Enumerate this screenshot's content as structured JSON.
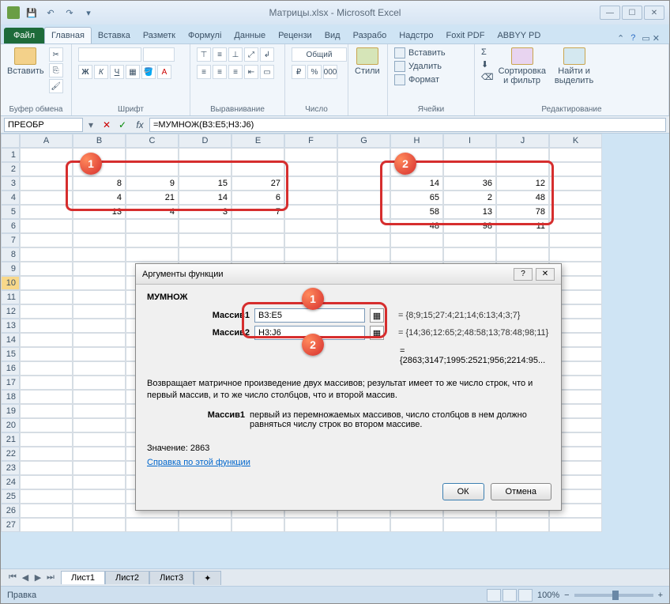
{
  "title": "Матрицы.xlsx - Microsoft Excel",
  "tabs": {
    "file": "Файл",
    "home": "Главная",
    "insert": "Вставка",
    "layout": "Разметк",
    "formulas": "Формулі",
    "data": "Данные",
    "review": "Рецензи",
    "view": "Вид",
    "dev": "Разрабо",
    "addins": "Надстро",
    "foxit": "Foxit PDF",
    "abbyy": "ABBYY PD"
  },
  "groups": {
    "clipboard": "Буфер обмена",
    "font": "Шрифт",
    "alignment": "Выравнивание",
    "number": "Число",
    "styles": "Стили",
    "cells": "Ячейки",
    "editing": "Редактирование"
  },
  "ribbon": {
    "paste": "Вставить",
    "general": "Общий",
    "styles": "Стили",
    "insert": "Вставить",
    "delete": "Удалить",
    "format": "Формат",
    "sort": "Сортировка и фильтр",
    "find": "Найти и выделить"
  },
  "name_box": "ПРЕОБР",
  "formula": "=МУМНОЖ(B3:E5;H3:J6)",
  "cols": [
    "A",
    "B",
    "C",
    "D",
    "E",
    "F",
    "G",
    "H",
    "I",
    "J",
    "K"
  ],
  "matrix1": [
    [
      8,
      9,
      15,
      27
    ],
    [
      4,
      21,
      14,
      6
    ],
    [
      13,
      4,
      3,
      7
    ]
  ],
  "matrix2": [
    [
      14,
      36,
      12
    ],
    [
      65,
      2,
      48
    ],
    [
      58,
      13,
      78
    ],
    [
      48,
      98,
      11
    ]
  ],
  "dialog": {
    "title": "Аргументы функции",
    "func": "МУМНОЖ",
    "arg1_label": "Массив1",
    "arg1_val": "B3:E5",
    "arg1_res": "= {8;9;15;27:4;21;14;6:13;4;3;7}",
    "arg2_label": "Массив2",
    "arg2_val": "H3:J6",
    "arg2_res": "= {14;36;12:65;2;48:58;13;78:48;98;11}",
    "result_preview": "= {2863;3147;1995:2521;956;2214:95...",
    "desc": "Возвращает матричное произведение двух массивов; результат имеет то же число строк, что и первый массив, и то же число столбцов, что и второй массив.",
    "arg_desc_label": "Массив1",
    "arg_desc": "первый из перемножаемых массивов, число столбцов в нем должно равняться числу строк во втором массиве.",
    "value_label": "Значение:",
    "value": "2863",
    "help": "Справка по этой функции",
    "ok": "ОК",
    "cancel": "Отмена"
  },
  "sheets": {
    "s1": "Лист1",
    "s2": "Лист2",
    "s3": "Лист3"
  },
  "status": "Правка",
  "zoom": "100%"
}
